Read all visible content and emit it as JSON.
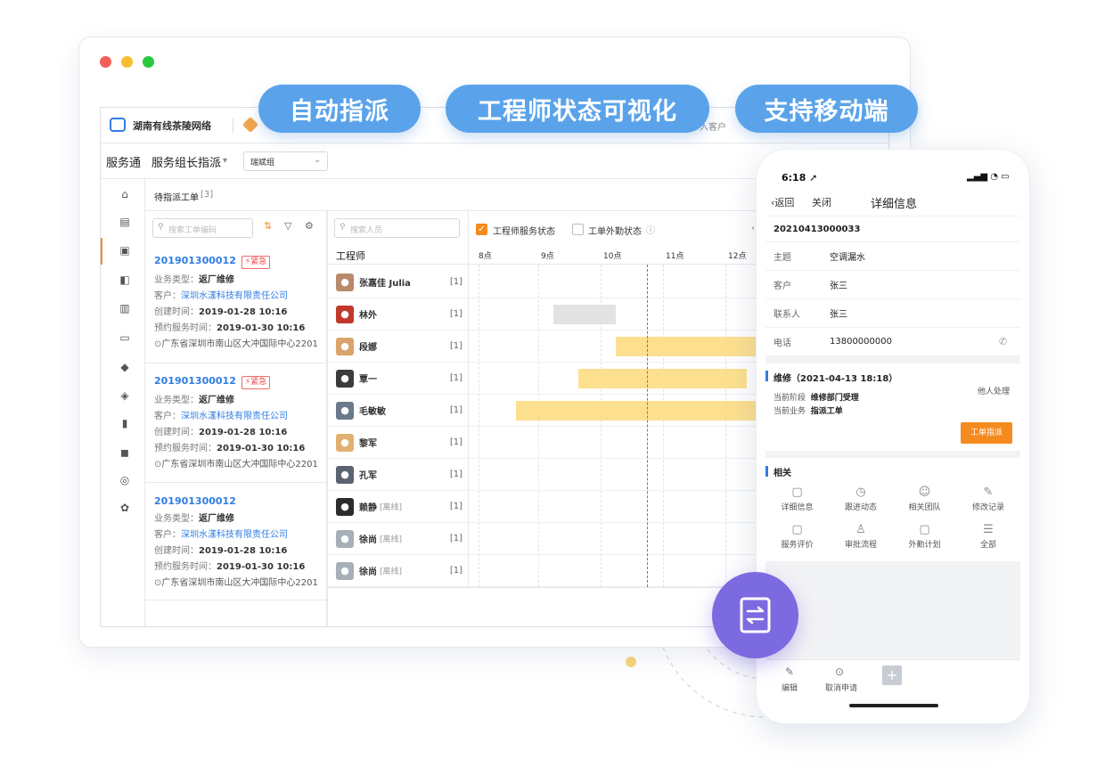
{
  "features": [
    "自动指派",
    "工程师状态可视化",
    "支持移动端"
  ],
  "app": {
    "company": "湖南有线茶陵网络",
    "top_right_hint": "入客户",
    "module_title": "服务通",
    "page_title": "服务组长指派",
    "group_select": "瑞斌组"
  },
  "orders_panel": {
    "header_label": "待指派工单",
    "header_count": "[3]",
    "search_placeholder": "搜索工单编码",
    "orders": [
      {
        "id": "201901300012",
        "urgent": "紧急",
        "type_label": "业务类型：",
        "type": "返厂维修",
        "customer_label": "客户：",
        "customer": "深圳水漾科技有限责任公司",
        "created_label": "创建时间：",
        "created": "2019-01-28 10:16",
        "appointment_label": "预约服务时间：",
        "appointment": "2019-01-30 10:16",
        "address": "广东省深圳市南山区大冲国际中心2201"
      },
      {
        "id": "201901300012",
        "urgent": "紧急",
        "type_label": "业务类型：",
        "type": "返厂维修",
        "customer_label": "客户：",
        "customer": "深圳水漾科技有限责任公司",
        "created_label": "创建时间：",
        "created": "2019-01-28 10:16",
        "appointment_label": "预约服务时间：",
        "appointment": "2019-01-30 10:16",
        "address": "广东省深圳市南山区大冲国际中心2201"
      },
      {
        "id": "201901300012",
        "urgent": "",
        "type_label": "业务类型：",
        "type": "返厂维修",
        "customer_label": "客户：",
        "customer": "深圳水漾科技有限责任公司",
        "created_label": "创建时间：",
        "created": "2019-01-28 10:16",
        "appointment_label": "预约服务时间：",
        "appointment": "2019-01-30 10:16",
        "address": "广东省深圳市南山区大冲国际中心2201"
      }
    ]
  },
  "engineers_panel": {
    "search_placeholder": "搜索人员",
    "header": "工程师",
    "engineers": [
      {
        "name": "张嘉佳 Julia",
        "status": "",
        "count": "[1]"
      },
      {
        "name": "林外",
        "status": "",
        "count": "[1]"
      },
      {
        "name": "段娜",
        "status": "",
        "count": "[1]"
      },
      {
        "name": "覃一",
        "status": "",
        "count": "[1]"
      },
      {
        "name": "毛敏敏",
        "status": "",
        "count": "[1]"
      },
      {
        "name": "黎军",
        "status": "",
        "count": "[1]"
      },
      {
        "name": "孔军",
        "status": "",
        "count": "[1]"
      },
      {
        "name": "赖静",
        "status": "[离线]",
        "count": "[1]"
      },
      {
        "name": "徐尚",
        "status": "[离线]",
        "count": "[1]"
      },
      {
        "name": "徐尚",
        "status": "[离线]",
        "count": "[1]"
      }
    ]
  },
  "timeline": {
    "checkbox_service": "工程师服务状态",
    "checkbox_service_checked": true,
    "checkbox_field": "工单外勤状态",
    "checkbox_field_checked": false,
    "hours": [
      "8点",
      "9点",
      "10点",
      "11点",
      "12点"
    ],
    "colors": {
      "busy": "#fde08f",
      "idle": "#e2e2e2",
      "now_line": "#e84a4a",
      "accent": "#f58a1f"
    },
    "bars": [
      {
        "row": 1,
        "start": 9.2,
        "end": 10.2,
        "kind": "idle"
      },
      {
        "row": 2,
        "start": 10.2,
        "end": 12.6,
        "kind": "busy"
      },
      {
        "row": 3,
        "start": 9.6,
        "end": 12.3,
        "kind": "busy"
      },
      {
        "row": 4,
        "start": 8.6,
        "end": 12.6,
        "kind": "busy"
      }
    ],
    "now": 10.7
  },
  "phone": {
    "time": "6:18",
    "nav_back": "返回",
    "nav_close": "关闭",
    "nav_title": "详细信息",
    "order_no": "20210413000033",
    "fields": [
      {
        "k": "主题",
        "v": "空调漏水"
      },
      {
        "k": "客户",
        "v": "张三"
      },
      {
        "k": "联系人",
        "v": "张三"
      },
      {
        "k": "电话",
        "v": "13800000000"
      }
    ],
    "repair_title": "维修（2021-04-13 18:18）",
    "repair_other": "他人处理",
    "stage_label": "当前阶段",
    "stage": "维修部门受理",
    "business_label": "当前业务",
    "business": "指派工单",
    "assign_button": "工单指派",
    "related_title": "相关",
    "related": [
      {
        "label": "详细信息",
        "icon": "detail-icon"
      },
      {
        "label": "跟进动态",
        "icon": "follow-icon"
      },
      {
        "label": "相关团队",
        "icon": "team-icon"
      },
      {
        "label": "修改记录",
        "icon": "edit-record-icon"
      },
      {
        "label": "服务评价",
        "icon": "rating-icon"
      },
      {
        "label": "审批流程",
        "icon": "approval-icon"
      },
      {
        "label": "外勤计划",
        "icon": "field-plan-icon"
      },
      {
        "label": "全部",
        "icon": "menu-icon"
      }
    ],
    "bottom_edit": "编辑",
    "bottom_cancel": "取消申请"
  }
}
